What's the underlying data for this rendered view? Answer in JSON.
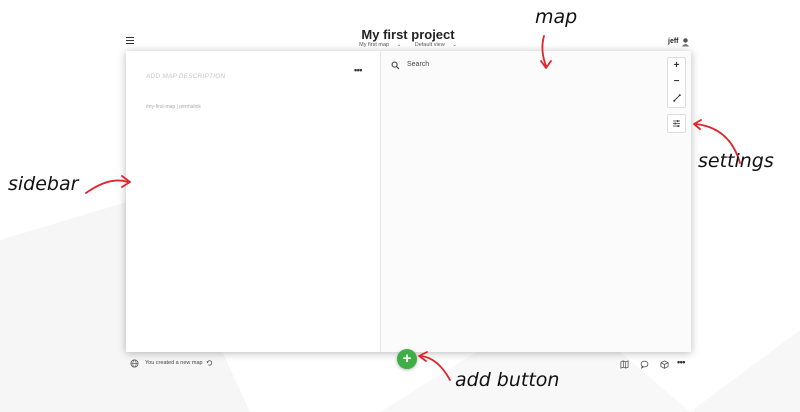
{
  "header": {
    "title": "My first project",
    "map_select": "My first map",
    "view_select": "Default view",
    "user": "jeff"
  },
  "sidebar": {
    "description_placeholder": "ADD MAP DESCRIPTION",
    "permalink": "/my-first-map | permalink",
    "more": "•••"
  },
  "map": {
    "search_placeholder": "Search",
    "zoom_in": "+",
    "zoom_out": "−"
  },
  "footer": {
    "status": "You created a new map",
    "add": "+",
    "more": "•••"
  },
  "annotations": {
    "map": "map",
    "settings": "settings",
    "sidebar": "sidebar",
    "add_button": "add button"
  },
  "colors": {
    "accent_green": "#3fae46",
    "annotation_red": "#e0242a"
  }
}
